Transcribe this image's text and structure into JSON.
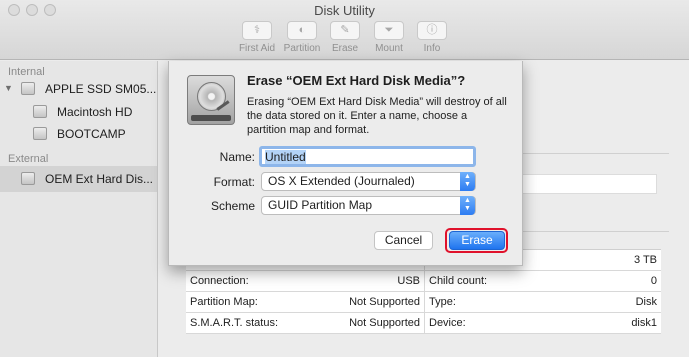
{
  "window": {
    "title": "Disk Utility"
  },
  "toolbar": {
    "items": [
      {
        "label": "First Aid",
        "icon": "stethoscope-icon"
      },
      {
        "label": "Partition",
        "icon": "partition-pie-icon"
      },
      {
        "label": "Erase",
        "icon": "erase-icon"
      },
      {
        "label": "Mount",
        "icon": "mount-icon"
      },
      {
        "label": "Info",
        "icon": "info-icon"
      }
    ]
  },
  "sidebar": {
    "internal_title": "Internal",
    "external_title": "External",
    "items": [
      {
        "label": "APPLE SSD SM05...",
        "icon": "internal-disk-icon"
      },
      {
        "label": "Macintosh HD",
        "icon": "volume-icon"
      },
      {
        "label": "BOOTCAMP",
        "icon": "volume-icon"
      },
      {
        "label": "OEM Ext Hard Dis...",
        "icon": "external-disk-icon"
      }
    ]
  },
  "info_table": {
    "rows": [
      {
        "left_label": "",
        "left_value": "",
        "right_label": "",
        "right_value": "3 TB"
      },
      {
        "left_label": "Connection:",
        "left_value": "USB",
        "right_label": "Child count:",
        "right_value": "0"
      },
      {
        "left_label": "Partition Map:",
        "left_value": "Not Supported",
        "right_label": "Type:",
        "right_value": "Disk"
      },
      {
        "left_label": "S.M.A.R.T. status:",
        "left_value": "Not Supported",
        "right_label": "Device:",
        "right_value": "disk1"
      }
    ]
  },
  "sheet": {
    "title": "Erase “OEM Ext Hard Disk Media”?",
    "message": "Erasing “OEM Ext Hard Disk Media” will destroy of all the data stored on it. Enter a name, choose a partition map and format.",
    "name_label": "Name:",
    "name_value": "Untitled",
    "format_label": "Format:",
    "format_value": "OS X Extended (Journaled)",
    "scheme_label": "Scheme",
    "scheme_value": "GUID Partition Map",
    "cancel_label": "Cancel",
    "erase_label": "Erase",
    "highlight_color": "#e0112b",
    "accent_color": "#2d7cf2"
  }
}
